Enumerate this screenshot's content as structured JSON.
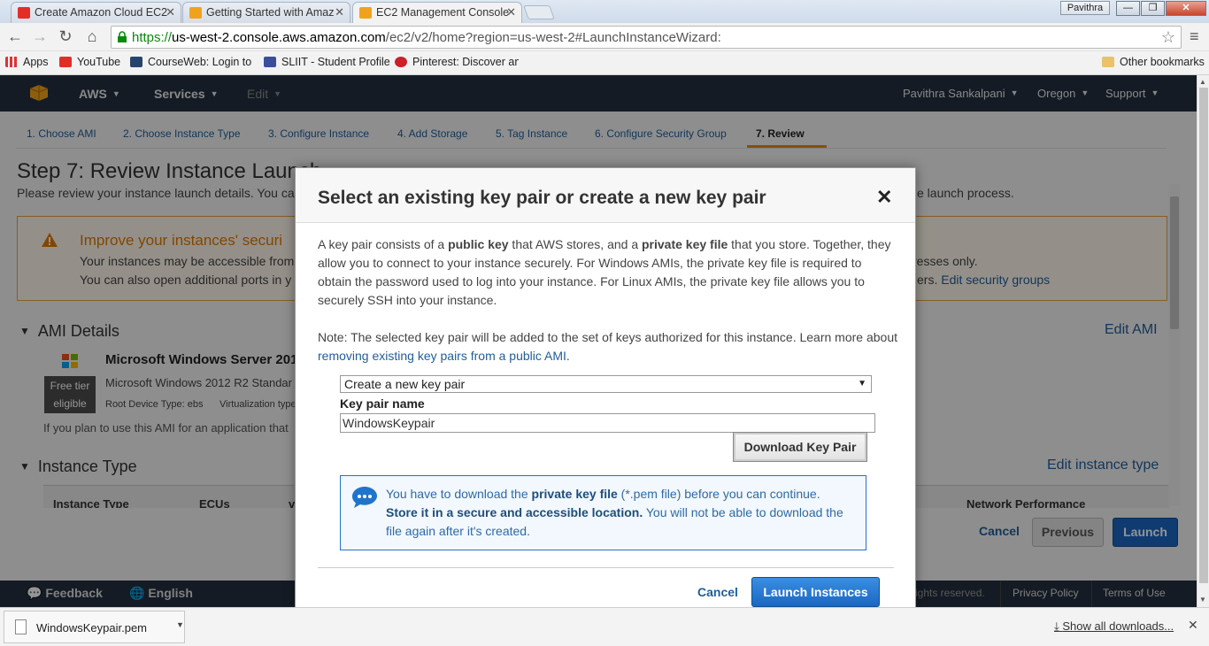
{
  "browser": {
    "tabs": [
      {
        "title": "Create Amazon Cloud EC2",
        "icon": "youtube-icon"
      },
      {
        "title": "Getting Started with Amaz",
        "icon": "aws-box-icon"
      },
      {
        "title": "EC2 Management Console",
        "icon": "aws-box-icon"
      }
    ],
    "user_badge": "Pavithra",
    "url_scheme": "https://",
    "url_host": "us-west-2.console.aws.amazon.com",
    "url_path": "/ec2/v2/home?region=us-west-2#LaunchInstanceWizard:",
    "bookmarks": [
      {
        "label": "Apps",
        "icon": "apps-grid-icon"
      },
      {
        "label": "YouTube",
        "icon": "youtube-icon"
      },
      {
        "label": "CourseWeb: Login to",
        "icon": "courseweb-icon"
      },
      {
        "label": "SLIIT - Student Profile",
        "icon": "sliit-icon"
      },
      {
        "label": "Pinterest: Discover an",
        "icon": "pinterest-icon"
      }
    ],
    "other_bookmarks": "Other bookmarks"
  },
  "aws_header": {
    "brand": "AWS",
    "services": "Services",
    "edit": "Edit",
    "user": "Pavithra Sankalpani",
    "region": "Oregon",
    "support": "Support"
  },
  "wizard": {
    "steps": [
      "1. Choose AMI",
      "2. Choose Instance Type",
      "3. Configure Instance",
      "4. Add Storage",
      "5. Tag Instance",
      "6. Configure Security Group",
      "7. Review"
    ],
    "title": "Step 7: Review Instance Launch",
    "desc_left": "Please review your instance launch details. You ca",
    "desc_right": "e launch process."
  },
  "warning": {
    "title": "Improve your instances' securi",
    "line1": "Your instances may be accessible from",
    "line1_right": "resses only.",
    "line2": "You can also open additional ports in y",
    "line2_right": "ers.",
    "edit_link": "Edit security groups"
  },
  "ami": {
    "heading": "AMI Details",
    "edit": "Edit AMI",
    "name": "Microsoft Windows Server 201",
    "free_tier_1": "Free tier",
    "free_tier_2": "eligible",
    "desc": "Microsoft Windows 2012 R2 Standar",
    "root": "Root Device Type: ebs",
    "virt": "Virtualization type",
    "note": "If you plan to use this AMI for an application that"
  },
  "instance_type": {
    "heading": "Instance Type",
    "edit": "Edit instance type",
    "columns": [
      "Instance Type",
      "ECUs",
      "v",
      "Network Performance"
    ]
  },
  "bottom_buttons": {
    "cancel": "Cancel",
    "previous": "Previous",
    "launch": "Launch"
  },
  "footer": {
    "feedback": "Feedback",
    "language": "English",
    "rights": "rights reserved.",
    "privacy": "Privacy Policy",
    "terms": "Terms of Use"
  },
  "modal": {
    "title": "Select an existing key pair or create a new key pair",
    "para1": {
      "t1": "A key pair consists of a ",
      "b1": "public key",
      "t2": " that AWS stores, and a ",
      "b2": "private key file",
      "t3": " that you store. Together, they allow you to connect to your instance securely. For Windows AMIs, the private key file is required to obtain the password used to log into your instance. For Linux AMIs, the private key file allows you to securely SSH into your instance."
    },
    "note_text": "Note: The selected key pair will be added to the set of keys authorized for this instance. Learn more about ",
    "note_link": "removing existing key pairs from a public AMI",
    "note_end": ".",
    "select_value": "Create a new key pair",
    "key_pair_label": "Key pair name",
    "key_pair_value": "WindowsKeypair",
    "download_button": "Download Key Pair",
    "info": {
      "l1a": "You have to download the ",
      "l1b": "private key file",
      "l1c": " (*.pem file) before you can continue.",
      "l2a": "Store it in a secure and accessible location.",
      "l2b": " You will not be able to download the",
      "l3": "file again after it's created."
    },
    "cancel": "Cancel",
    "launch": "Launch Instances"
  },
  "download_bar": {
    "file": "WindowsKeypair.pem",
    "show_all": "Show all downloads..."
  },
  "colors": {
    "aws_dark": "#232f3e",
    "link_blue": "#1f5e9c",
    "primary_button": "#1a67c3",
    "warning_orange": "#e07900"
  }
}
